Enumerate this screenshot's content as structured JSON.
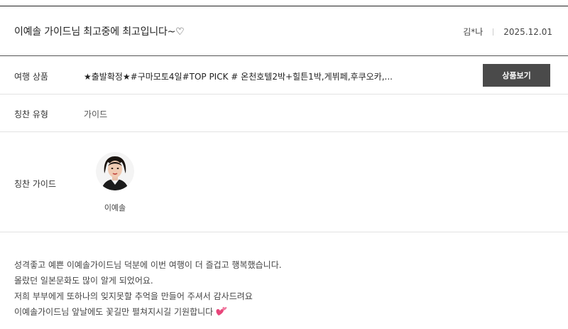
{
  "review": {
    "title": "이예솔 가이드님 최고중에 최고입니다~♡",
    "author": "김*나",
    "date": "2025.12.01"
  },
  "product": {
    "label": "여행 상품",
    "value": "★출발확정★#구마모토4일#TOP PICK # 온천호텔2박+힐튼1박,게뷔페,후쿠오카,...",
    "button_label": "상품보기"
  },
  "praise_type": {
    "label": "칭찬 유형",
    "value": "가이드"
  },
  "praise_guide": {
    "label": "칭찬 가이드",
    "name": "이예솔",
    "avatar_icon": "guide-portrait-photo"
  },
  "message": {
    "lines": [
      "성격좋고 예쁜 이예솔가이드님 덕분에 이번 여행이 더 즐겁고 행복했습니다.",
      "몰랐던 일본문화도 많이 알게 되었어요.",
      "저희 부부에게 또하나의 잊지못할 추억을 만들어 주셔서 감사드려요",
      "이예솔가이드님 앞날에도 꽃길만 펼쳐지시길 기원합니다"
    ],
    "emoji_icon": "two-hearts-icon"
  },
  "colors": {
    "button_bg": "#4a4a4a",
    "heart": "#e8457a"
  }
}
